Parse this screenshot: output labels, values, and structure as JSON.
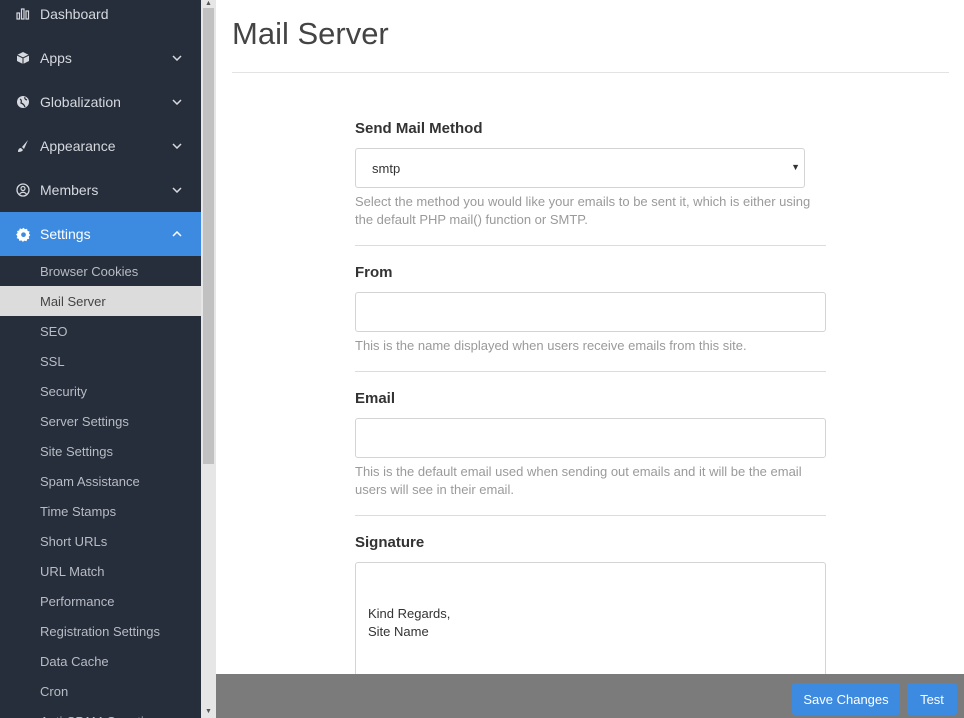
{
  "sidebar": {
    "items": [
      {
        "label": "Dashboard",
        "icon": "bar-chart-icon"
      },
      {
        "label": "Apps",
        "icon": "cube-icon"
      },
      {
        "label": "Globalization",
        "icon": "globe-icon"
      },
      {
        "label": "Appearance",
        "icon": "brush-icon"
      },
      {
        "label": "Members",
        "icon": "user-circle-icon"
      },
      {
        "label": "Settings",
        "icon": "gear-icon"
      }
    ],
    "settings_submenu": [
      "Browser Cookies",
      "Mail Server",
      "SEO",
      "SSL",
      "Security",
      "Server Settings",
      "Site Settings",
      "Spam Assistance",
      "Time Stamps",
      "Short URLs",
      "URL Match",
      "Performance",
      "Registration Settings",
      "Data Cache",
      "Cron",
      "Anti-SPAM Questions"
    ],
    "active_item": "Settings",
    "active_sub_item": "Mail Server"
  },
  "page": {
    "title": "Mail Server"
  },
  "form": {
    "send_mail_method": {
      "label": "Send Mail Method",
      "value": "smtp",
      "help": "Select the method you would like your emails to be sent it, which is either using the default PHP mail() function or SMTP."
    },
    "from": {
      "label": "From",
      "value": "",
      "help": "This is the name displayed when users receive emails from this site."
    },
    "email": {
      "label": "Email",
      "value": "",
      "help": "This is the default email used when sending out emails and it will be the email users will see in their email."
    },
    "signature": {
      "label": "Signature",
      "value": "Kind Regards,\nSite Name"
    }
  },
  "footer": {
    "save_label": "Save Changes",
    "test_label": "Test"
  },
  "colors": {
    "sidebar_bg": "#262d3b",
    "accent": "#3c8be0",
    "footer_bg": "#7b7b7b"
  }
}
